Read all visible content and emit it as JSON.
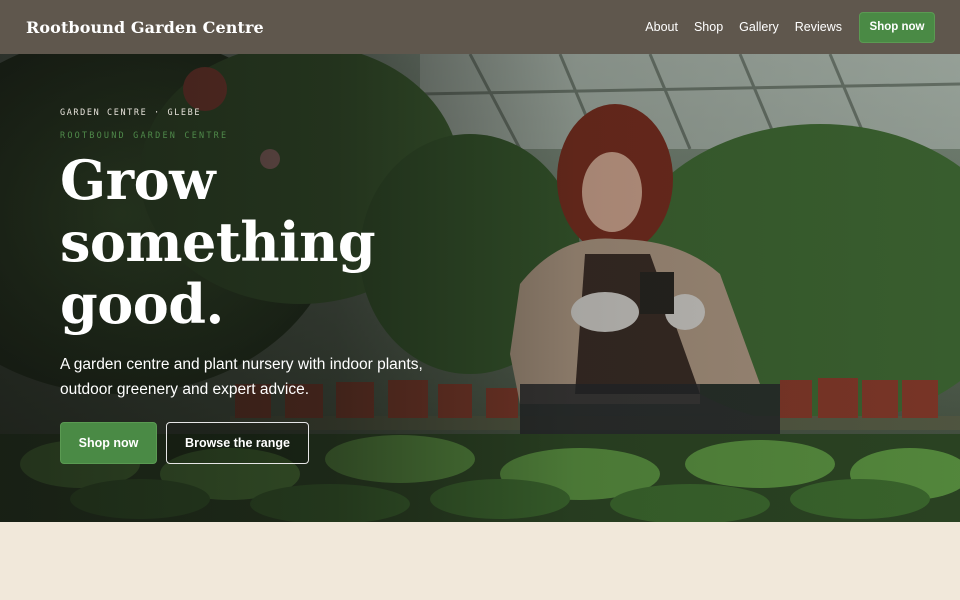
{
  "header": {
    "brand": "Rootbound Garden Centre",
    "nav": [
      "About",
      "Shop",
      "Gallery",
      "Reviews"
    ],
    "cta": "Shop now"
  },
  "hero": {
    "eyebrow": "GARDEN CENTRE · GLEBE",
    "eyebrow_secondary": "ROOTBOUND GARDEN CENTRE",
    "headline": [
      "Grow",
      "something",
      "good."
    ],
    "lede": "A garden centre and plant nursery with indoor plants, outdoor greenery and expert advice.",
    "primary_cta": "Shop now",
    "secondary_cta": "Browse the range",
    "image_alt": "greenhouse-worker-potting-plants"
  },
  "colors": {
    "header_bg": "#5f574d",
    "accent_green": "#4a8a45",
    "page_bg": "#f1e8da"
  }
}
